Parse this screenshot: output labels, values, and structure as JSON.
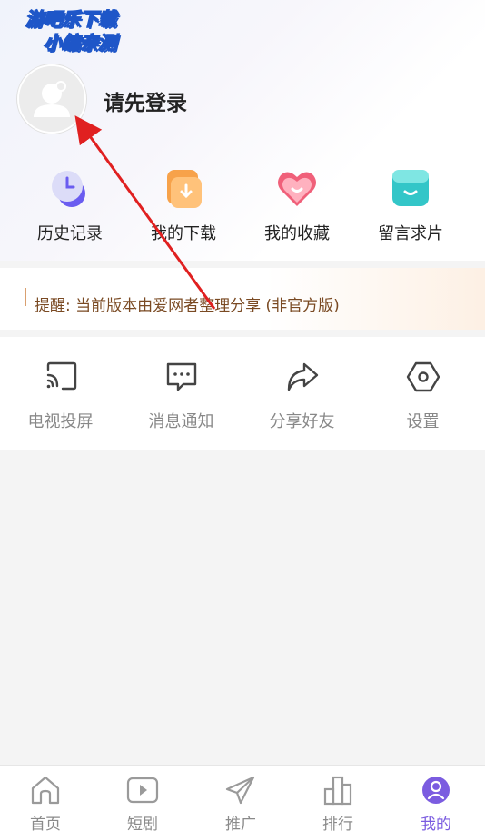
{
  "watermark": {
    "line1": "游吧乐下载",
    "line2": "小编亲测"
  },
  "profile": {
    "login_prompt": "请先登录"
  },
  "quick_actions": [
    {
      "label": "历史记录",
      "icon": "history-clock-icon"
    },
    {
      "label": "我的下载",
      "icon": "download-icon"
    },
    {
      "label": "我的收藏",
      "icon": "favorite-heart-icon"
    },
    {
      "label": "留言求片",
      "icon": "message-request-icon"
    }
  ],
  "notice": {
    "text": "提醒: 当前版本由爱网者整理分享 (非官方版)"
  },
  "tools": [
    {
      "label": "电视投屏",
      "icon": "cast-screen-icon"
    },
    {
      "label": "消息通知",
      "icon": "message-bubble-icon"
    },
    {
      "label": "分享好友",
      "icon": "share-icon"
    },
    {
      "label": "设置",
      "icon": "settings-hexagon-icon"
    }
  ],
  "tabbar": {
    "items": [
      {
        "label": "首页",
        "icon": "home-icon",
        "active": false
      },
      {
        "label": "短剧",
        "icon": "video-play-icon",
        "active": false
      },
      {
        "label": "推广",
        "icon": "send-plane-icon",
        "active": false
      },
      {
        "label": "排行",
        "icon": "ranking-bars-icon",
        "active": false
      },
      {
        "label": "我的",
        "icon": "user-profile-icon",
        "active": true
      }
    ]
  },
  "colors": {
    "accent": "#7b5ce0",
    "arrow": "#e02020",
    "notice_text": "#7a4a23",
    "watermark_stroke": "#1e56c8"
  }
}
